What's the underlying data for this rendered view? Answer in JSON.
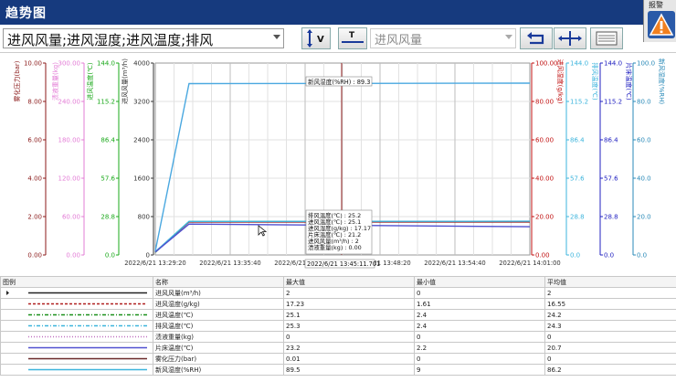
{
  "window": {
    "title": "趋势图"
  },
  "alarm": {
    "label": "报警"
  },
  "toolbar": {
    "series_combo": "进风风量;进风湿度;进风温度;排风",
    "field_combo": "进风风量",
    "icon_v": "V",
    "icon_t": "T"
  },
  "colors": {
    "pressure": "#8b1a1a",
    "waste": "#e37cd6",
    "inlet_temp": "#1aa81a",
    "airflow": "#6c6c6c",
    "humidity": "#c01010",
    "exhaust": "#3cb4dc",
    "filter": "#2020c0",
    "moisture": "#2a8ab8"
  },
  "chart": {
    "tooltip_top": "新风湿度(%RH) : 89.3",
    "tooltip_lines": [
      "排风温度(℃) : 25.2",
      "进风温度(℃) : 25.1",
      "进风湿度(g/kg) : 17.17",
      "片床温度(℃) : 21.2",
      "进风风量(m³/h) : 2",
      "渍液重量(kg) : 0.00"
    ],
    "cursor_time": "2022/6/21 13:45:11.701"
  },
  "chart_data": {
    "type": "line",
    "x_ticks": [
      "2022/6/21 13:29:20",
      "2022/6/21 13:35:40",
      "2022/6/21 13:42:00",
      "2022/6/21 13:48:20",
      "2022/6/21 13:54:40",
      "2022/6/21 14:01:00"
    ],
    "axes_left": [
      {
        "name": "雾化压力(bar)",
        "ticks": [
          "0.00",
          "2.00",
          "4.00",
          "6.00",
          "8.00",
          "10.00"
        ],
        "color": "#8b1a1a"
      },
      {
        "name": "渍液重量(kg)",
        "ticks": [
          "0.00",
          "60.00",
          "120.00",
          "180.00",
          "240.00",
          "300.00"
        ],
        "color": "#e37cd6"
      },
      {
        "name": "进风温度(℃)",
        "ticks": [
          "0.0",
          "28.8",
          "57.6",
          "86.4",
          "115.2",
          "144.0"
        ],
        "color": "#1aa81a"
      },
      {
        "name": "进风风量(m³/h)",
        "ticks": [
          "0",
          "800",
          "1600",
          "2400",
          "3200",
          "4000"
        ],
        "color": "#333333"
      }
    ],
    "axes_right": [
      {
        "name": "进风湿度(g/kg)",
        "ticks": [
          "0.00",
          "20.00",
          "40.00",
          "60.00",
          "80.00",
          "100.00"
        ],
        "color": "#c01010"
      },
      {
        "name": "排风温度(℃)",
        "ticks": [
          "0.0",
          "28.8",
          "57.6",
          "86.4",
          "115.2",
          "144.0"
        ],
        "color": "#3cb4dc"
      },
      {
        "name": "片床温度(℃)",
        "ticks": [
          "0.0",
          "28.8",
          "57.6",
          "86.4",
          "115.2",
          "144.0"
        ],
        "color": "#2020c0"
      },
      {
        "name": "新风湿度(%RH)",
        "ticks": [
          "0.0",
          "20.0",
          "40.0",
          "60.0",
          "80.0",
          "100.0"
        ],
        "color": "#2a8ab8"
      }
    ],
    "series": [
      {
        "name": "新风湿度",
        "axis_max": 100,
        "x": [
          0,
          0.09,
          1
        ],
        "y": [
          2,
          89.3,
          89.5
        ],
        "color": "#4aa8e0"
      },
      {
        "name": "进风温度",
        "axis_max": 144,
        "x": [
          0,
          0.09,
          1
        ],
        "y": [
          2,
          25.1,
          25.1
        ],
        "color": "#1aa81a"
      },
      {
        "name": "进风湿度",
        "axis_max": 100,
        "x": [
          0,
          0.09,
          1
        ],
        "y": [
          1.6,
          17.2,
          17.2
        ],
        "color": "#9a1a1a"
      },
      {
        "name": "排风温度",
        "axis_max": 144,
        "x": [
          0,
          0.09,
          1
        ],
        "y": [
          2.4,
          25.2,
          25.3
        ],
        "color": "#3cb4dc"
      },
      {
        "name": "片床温度",
        "axis_max": 144,
        "x": [
          0,
          0.09,
          1
        ],
        "y": [
          2.2,
          23.2,
          21.2
        ],
        "color": "#5050d0"
      }
    ]
  },
  "table": {
    "headers": [
      "图例",
      "名称",
      "最大值",
      "最小值",
      "平均值"
    ],
    "rows": [
      {
        "name": "进风风量(m³/h)",
        "max": "2",
        "min": "0",
        "avg": "2",
        "color": "#222222",
        "dash": ""
      },
      {
        "name": "进风湿度(g/kg)",
        "max": "17.23",
        "min": "1.61",
        "avg": "16.55",
        "color": "#b02020",
        "dash": "3,2"
      },
      {
        "name": "进风温度(℃)",
        "max": "25.1",
        "min": "2.4",
        "avg": "24.2",
        "color": "#1a901a",
        "dash": "4,2,1,2"
      },
      {
        "name": "排风温度(℃)",
        "max": "25.3",
        "min": "2.4",
        "avg": "24.3",
        "color": "#3cb4dc",
        "dash": "4,2,1,2"
      },
      {
        "name": "渍液重量(kg)",
        "max": "0",
        "min": "0",
        "avg": "0",
        "color": "#c070c0",
        "dash": "1,2"
      },
      {
        "name": "片床温度(℃)",
        "max": "23.2",
        "min": "2.2",
        "avg": "20.7",
        "color": "#5050d0",
        "dash": ""
      },
      {
        "name": "雾化压力(bar)",
        "max": "0.01",
        "min": "0",
        "avg": "0",
        "color": "#6a2a2a",
        "dash": ""
      },
      {
        "name": "新风湿度(%RH)",
        "max": "89.5",
        "min": "9",
        "avg": "86.2",
        "color": "#3cb4dc",
        "dash": ""
      }
    ]
  }
}
